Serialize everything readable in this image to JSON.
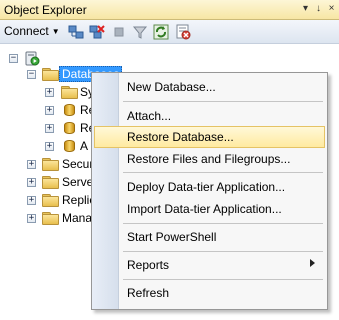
{
  "window": {
    "title": "Object Explorer",
    "pin_glyph": "↓",
    "menu_glyph": "▾",
    "close_glyph": "×"
  },
  "toolbar": {
    "connect_label": "Connect",
    "icons": [
      "connect-icon",
      "disconnect-icon",
      "stop-icon",
      "filter-icon",
      "refresh-icon",
      "summary-icon"
    ]
  },
  "tree": {
    "root": {
      "icon": "server-icon",
      "expander": "−"
    },
    "databases": {
      "label": "Databases",
      "expander": "−"
    },
    "database_children": [
      {
        "label": "Sy",
        "icon": "folder-icon",
        "expander": "+"
      },
      {
        "label": "Re",
        "icon": "database-icon",
        "expander": "+"
      },
      {
        "label": "Re",
        "icon": "database-icon",
        "expander": "+"
      },
      {
        "label": "A",
        "icon": "database-icon",
        "expander": "+"
      }
    ],
    "siblings": [
      {
        "label": "Secur",
        "icon": "folder-icon",
        "expander": "+"
      },
      {
        "label": "Serve",
        "icon": "folder-icon",
        "expander": "+"
      },
      {
        "label": "Replic",
        "icon": "folder-icon",
        "expander": "+"
      },
      {
        "label": "Mana",
        "icon": "folder-icon",
        "expander": "+"
      }
    ]
  },
  "context_menu": {
    "items": [
      {
        "label": "New Database..."
      },
      {
        "label": "Attach..."
      },
      {
        "label": "Restore Database...",
        "highlighted": true
      },
      {
        "label": "Restore Files and Filegroups..."
      },
      {
        "label": "Deploy Data-tier Application..."
      },
      {
        "label": "Import Data-tier Application..."
      },
      {
        "label": "Start PowerShell"
      },
      {
        "label": "Reports",
        "has_submenu": true
      },
      {
        "label": "Refresh"
      }
    ]
  },
  "colors": {
    "selection": "#3399ff",
    "menu_hover_border": "#e5c365",
    "menu_hover_fill": "#ffeaa0",
    "titlebar": "#f7e6a4"
  }
}
